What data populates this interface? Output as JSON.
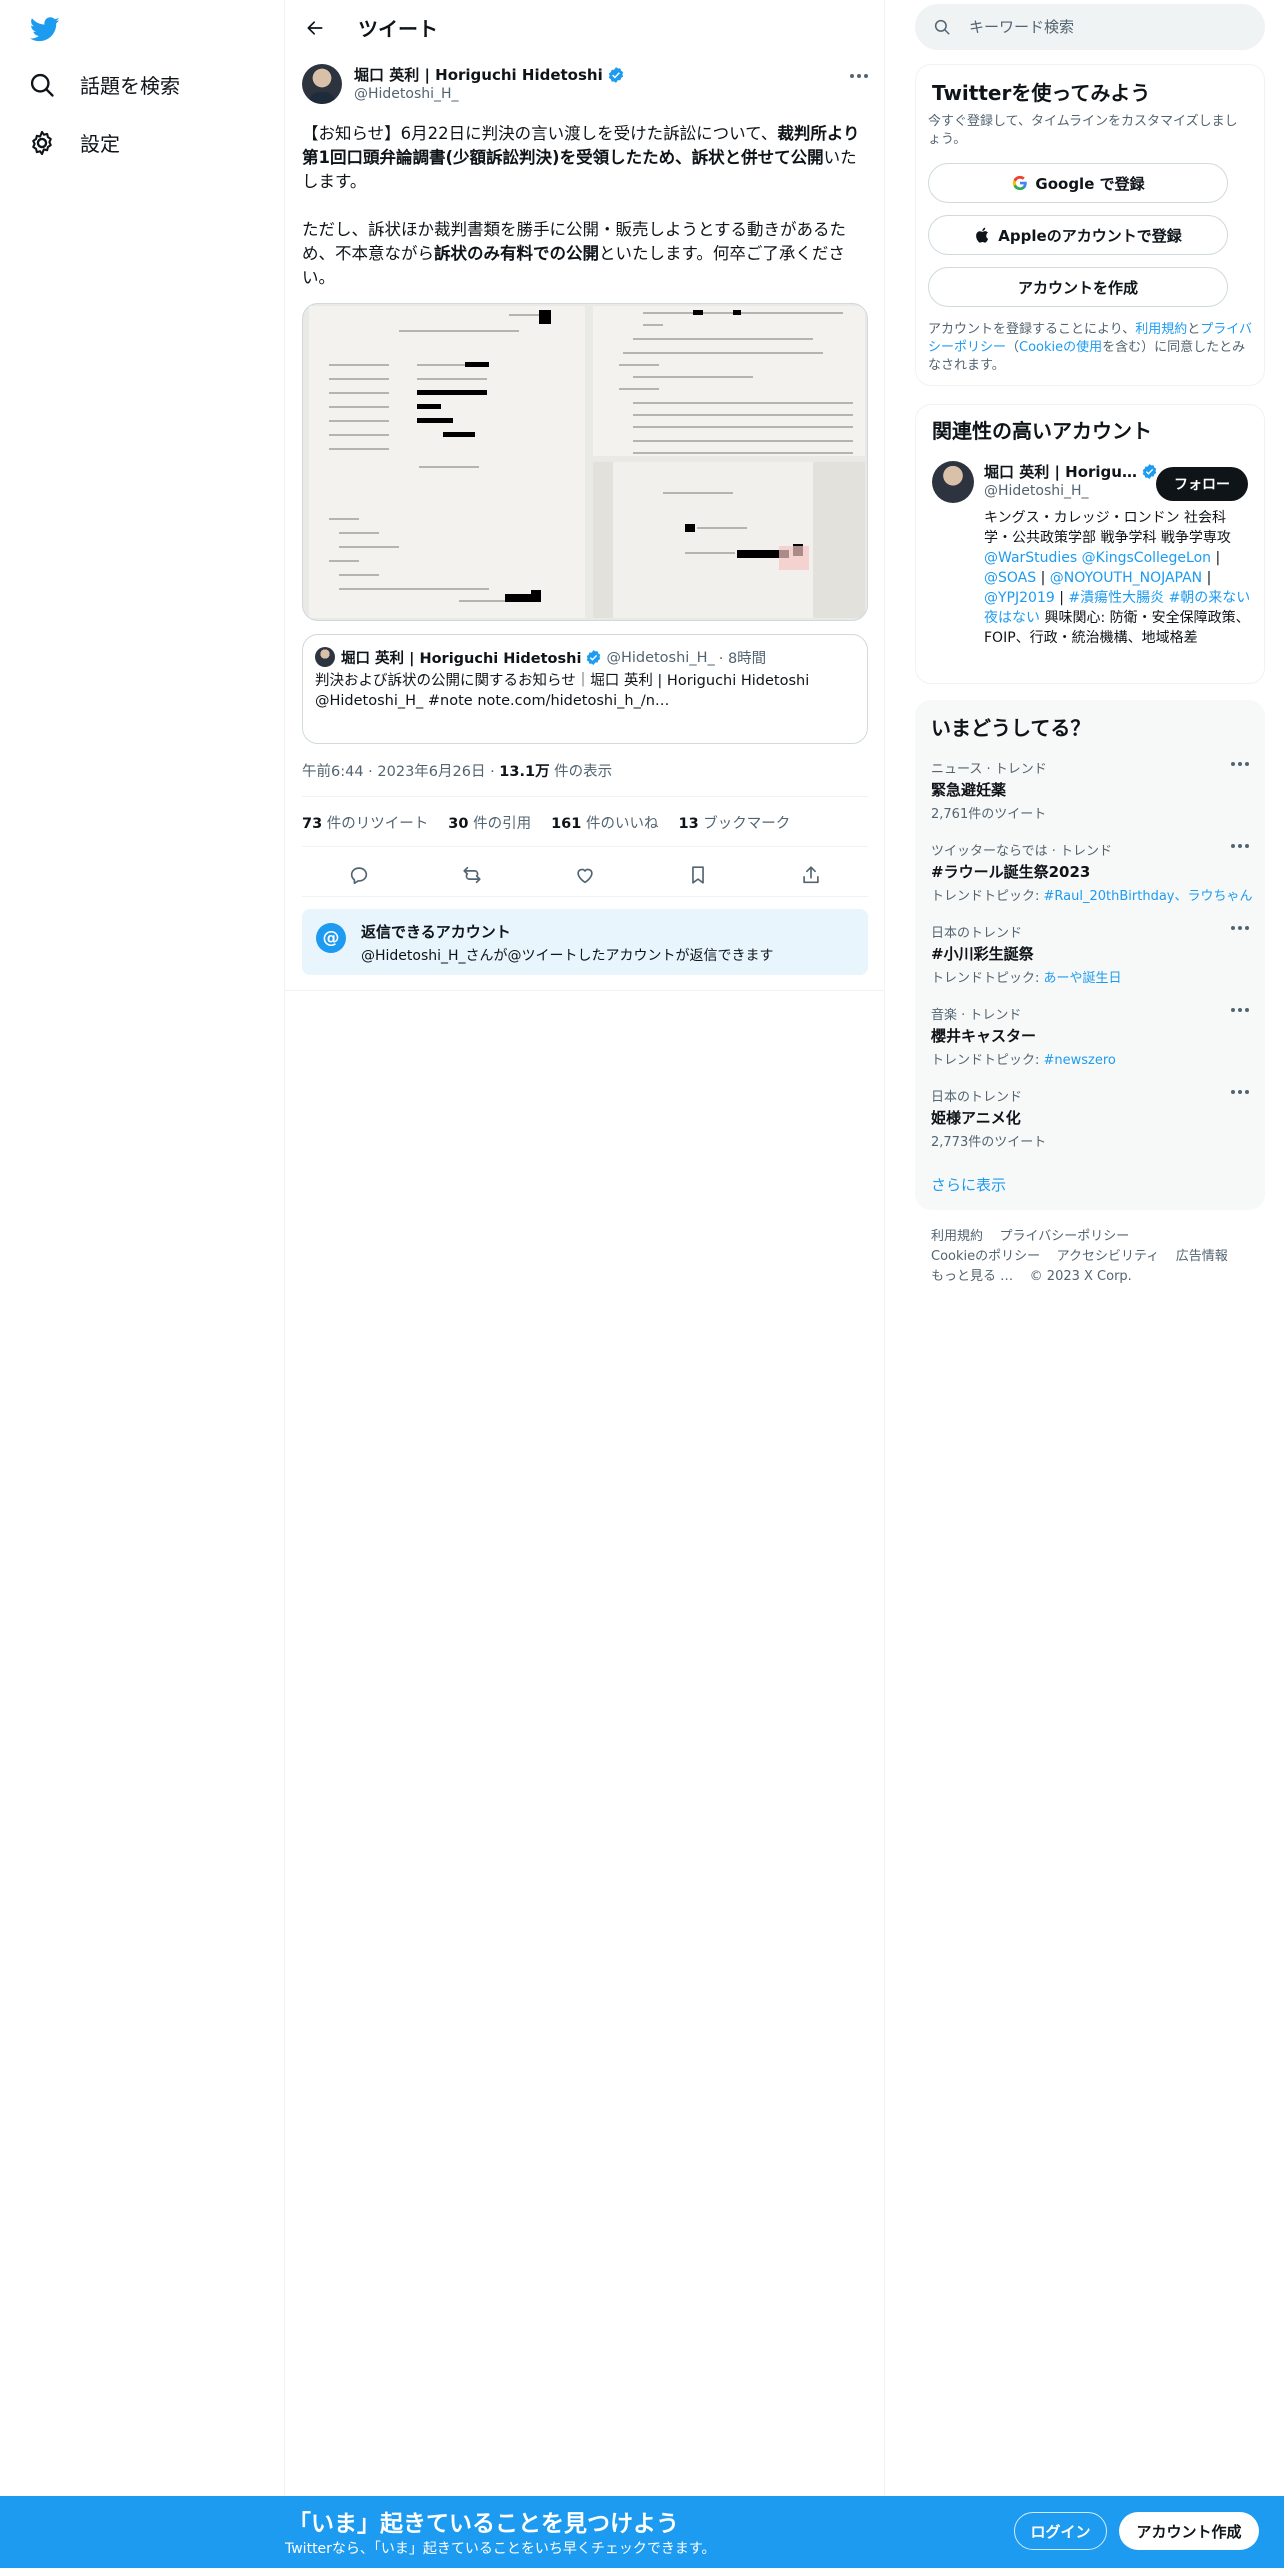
{
  "nav": {
    "items": [
      {
        "label": "話題を検索",
        "icon": "search-icon"
      },
      {
        "label": "設定",
        "icon": "gear-icon"
      }
    ]
  },
  "header": {
    "title": "ツイート"
  },
  "tweet": {
    "author_name": "堀口 英利 | Horiguchi Hidetoshi",
    "author_handle": "@Hidetoshi_H_",
    "p1_a": "【お知らせ】6月22日に判決の言い渡しを受けた訴訟について、",
    "p1_b": "裁判所より第1回口頭弁論調書(少額訴訟判決)を受領したため、訴状と併せて公開",
    "p1_c": "いたします。",
    "p2_a": "ただし、訴状ほか裁判書類を勝手に公開・販売しようとする動きがあるため、不本意ながら",
    "p2_b": "訴状のみ有料での公開",
    "p2_c": "といたします。何卒ご了承ください。",
    "timestamp": "午前6:44 · 2023年6月26日 · ",
    "views_count": "13.1万",
    "views_label": " 件の表示"
  },
  "quote": {
    "name": "堀口 英利 | Horiguchi Hidetoshi",
    "handle": "@Hidetoshi_H_",
    "time": "· 8時間",
    "text": "判決および訴状の公開に関するお知らせ｜堀口 英利 | Horiguchi Hidetoshi @Hidetoshi_H_ #note note.com/hidetoshi_h_/n…"
  },
  "stats": [
    {
      "count": "73",
      "label": " 件のリツイート"
    },
    {
      "count": "30",
      "label": " 件の引用"
    },
    {
      "count": "161",
      "label": " 件のいいね"
    },
    {
      "count": "13",
      "label": " ブックマーク"
    }
  ],
  "reply_restriction": {
    "title": "返信できるアカウント",
    "subtitle": "@Hidetoshi_H_さんが@ツイートしたアカウントが返信できます"
  },
  "search": {
    "placeholder": "キーワード検索"
  },
  "signup_card": {
    "title": "Twitterを使ってみよう",
    "subtitle": "今すぐ登録して、タイムラインをカスタマイズしましょう。",
    "google": "Google で登録",
    "apple": "Appleのアカウントで登録",
    "create": "アカウントを作成",
    "legal_a": "アカウントを登録することにより、",
    "legal_terms": "利用規約",
    "legal_and": "と",
    "legal_privacy": "プライバシーポリシー",
    "legal_paren_open": "（",
    "legal_cookie": "Cookieの使用",
    "legal_b": "を含む）に同意したとみなされます。"
  },
  "related": {
    "title": "関連性の高いアカウント",
    "name": "堀口 英利 | Horigu…",
    "handle": "@Hidetoshi_H_",
    "follow": "フォロー",
    "bio_a": "キングス・カレッジ・ロンドン 社会科学・公共政策学部 戦争学科 戦争学専攻 ",
    "bio_links1": "@WarStudies @KingsCollegeLon",
    "bio_sep1": " | ",
    "bio_links2": "@SOAS",
    "bio_sep2": " | ",
    "bio_links3": "@NOYOUTH_NOJAPAN",
    "bio_sep3": " | ",
    "bio_links4": "@YPJ2019",
    "bio_sep4": " | ",
    "bio_links5": "#潰瘍性大腸炎 #朝の来ない夜はない",
    "bio_b": " 興味関心: 防衛・安全保障政策、FOIP、行政・統治機構、地域格差"
  },
  "trends": {
    "title": "いまどうしてる？",
    "items": [
      {
        "context": "ニュース · トレンド",
        "name": "緊急避妊薬",
        "sub": "2,761件のツイート",
        "link": ""
      },
      {
        "context": "ツイッターならでは · トレンド",
        "name": "#ラウール誕生祭2023",
        "sub": "トレンドトピック: ",
        "link": "#Raul_20thBirthday、ラウちゃん"
      },
      {
        "context": "日本のトレンド",
        "name": "#小川彩生誕祭",
        "sub": "トレンドトピック: ",
        "link": "あーや誕生日"
      },
      {
        "context": "音楽 · トレンド",
        "name": "櫻井キャスター",
        "sub": "トレンドトピック: ",
        "link": "#newszero"
      },
      {
        "context": "日本のトレンド",
        "name": "姫様アニメ化",
        "sub": "2,773件のツイート",
        "link": ""
      }
    ],
    "show_more": "さらに表示"
  },
  "footer": {
    "terms": "利用規約",
    "privacy": "プライバシーポリシー",
    "cookie": "Cookieのポリシー",
    "accessibility": "アクセシビリティ",
    "ads": "広告情報",
    "more": "もっと見る …",
    "copyright": "© 2023 X Corp."
  },
  "bottom_bar": {
    "title": "「いま」起きていることを見つけよう",
    "subtitle": "Twitterなら、「いま」起きていることをいち早くチェックできます。",
    "login": "ログイン",
    "signup": "アカウント作成"
  },
  "colors": {
    "accent": "#1d9bf0",
    "text": "#0f1419",
    "secondary": "#536471"
  }
}
